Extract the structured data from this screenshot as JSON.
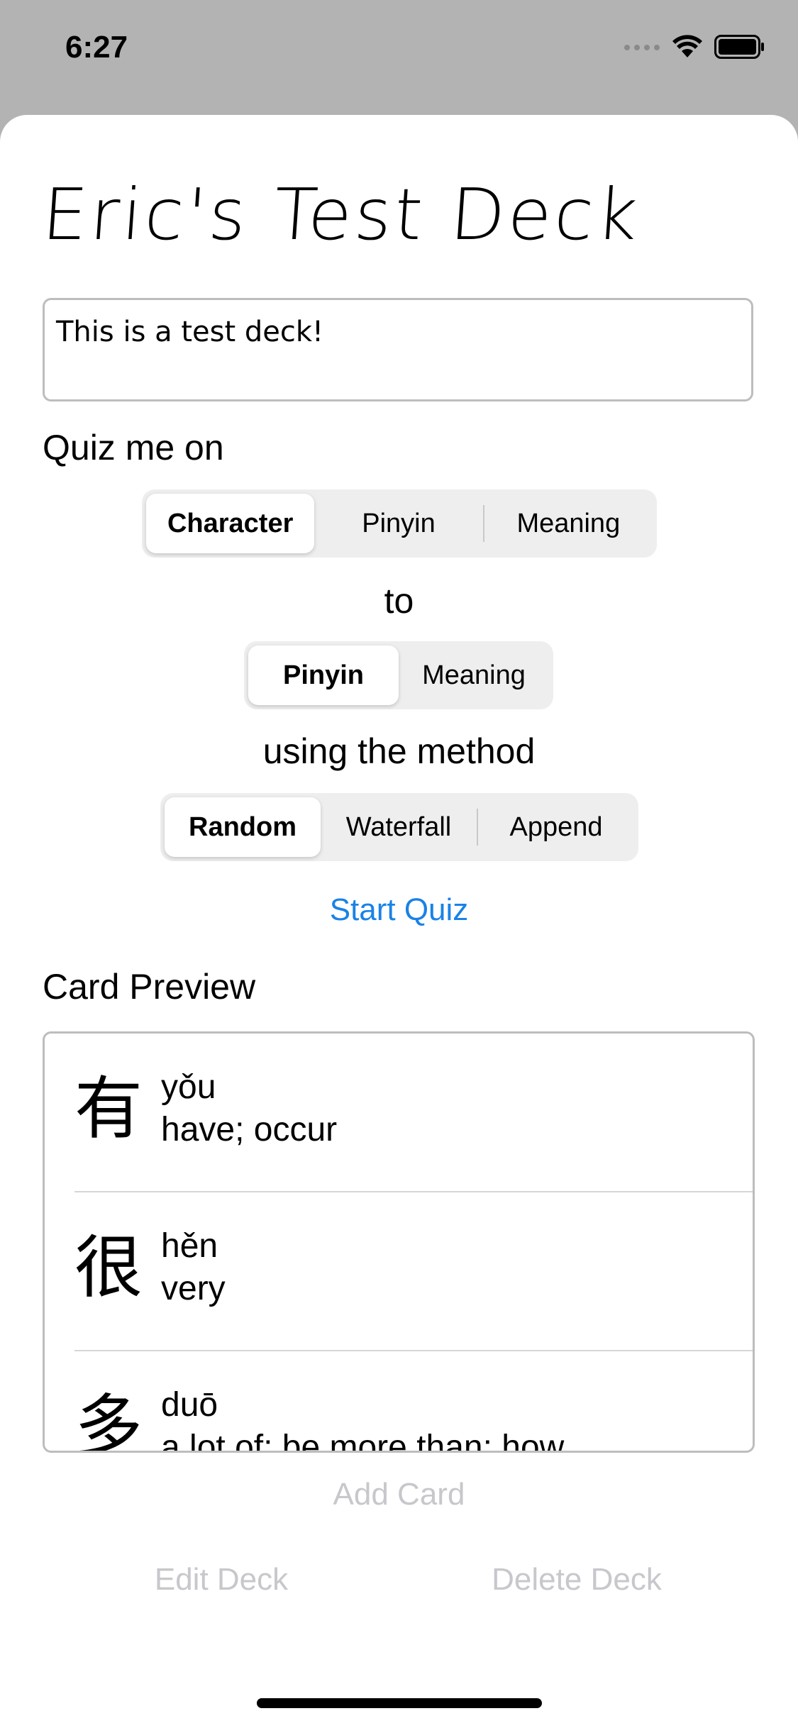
{
  "status_bar": {
    "time": "6:27"
  },
  "deck": {
    "title": "Eric's Test Deck",
    "description": "This is a test deck!"
  },
  "quiz": {
    "quiz_me_on_label": "Quiz me on",
    "from_options": [
      "Character",
      "Pinyin",
      "Meaning"
    ],
    "from_selected": "Character",
    "to_label": "to",
    "to_options": [
      "Pinyin",
      "Meaning"
    ],
    "to_selected": "Pinyin",
    "method_label": "using the method",
    "method_options": [
      "Random",
      "Waterfall",
      "Append"
    ],
    "method_selected": "Random",
    "start_label": "Start Quiz"
  },
  "preview": {
    "label": "Card Preview",
    "cards": [
      {
        "character": "有",
        "pinyin": "yǒu",
        "meaning": "have; occur"
      },
      {
        "character": "很",
        "pinyin": "hěn",
        "meaning": "very"
      },
      {
        "character": "多",
        "pinyin": "duō",
        "meaning": "a lot of; be more than; how"
      }
    ]
  },
  "actions": {
    "add_card": "Add Card",
    "edit_deck": "Edit Deck",
    "delete_deck": "Delete Deck"
  },
  "colors": {
    "link": "#1a82e6",
    "disabled": "#c7c7cc",
    "backdrop": "#b3b3b3"
  }
}
